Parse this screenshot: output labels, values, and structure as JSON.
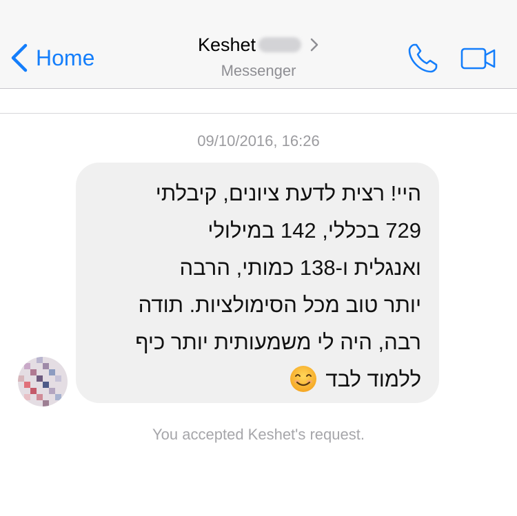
{
  "navbar": {
    "back_label": "Home",
    "title": "Keshet",
    "subtitle": "Messenger",
    "accent_color": "#147efb"
  },
  "conversation": {
    "timestamp": "09/10/2016, 16:26",
    "message_lines": [
      "היי! רצית לדעת ציונים, קיבלתי",
      "729 בכללי, 142 במילולי",
      "ואנגלית ו-138 כמותי, הרבה",
      "יותר טוב מכל הסימולציות. תודה",
      "רבה, היה לי משמעותית יותר כיף",
      "ללמוד לבד"
    ],
    "emoji": "smiling-face-icon",
    "system_note": "You accepted Keshet's request."
  },
  "icons": {
    "back": "chevron-left-icon",
    "call": "phone-icon",
    "video": "video-camera-icon",
    "title_chevron": "chevron-right-icon"
  }
}
